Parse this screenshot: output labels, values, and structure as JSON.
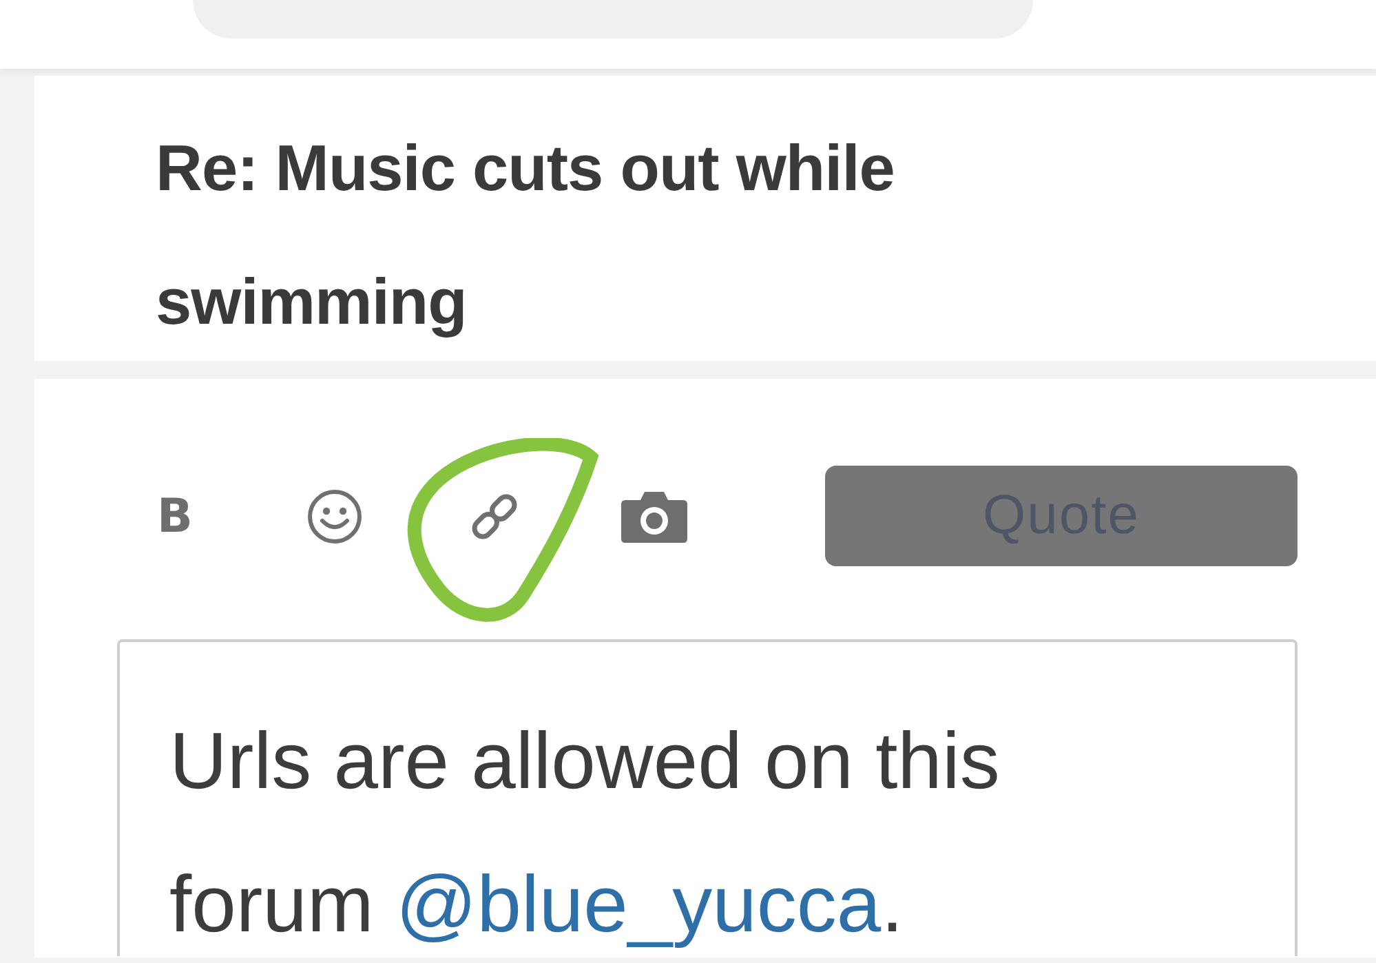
{
  "title": "Re: Music cuts out while swimming",
  "toolbar": {
    "tools": [
      {
        "kind": "bold",
        "label": "B"
      },
      {
        "kind": "emoji"
      },
      {
        "kind": "link",
        "highlighted": true
      },
      {
        "kind": "camera"
      }
    ],
    "quote_button": {
      "label": "Quote",
      "disabled": true
    }
  },
  "editor": {
    "text": "Urls are allowed on this forum ",
    "mention": "@blue_yucca",
    "after": "."
  },
  "annotation": {
    "kind": "circle",
    "color": "#86c440"
  }
}
